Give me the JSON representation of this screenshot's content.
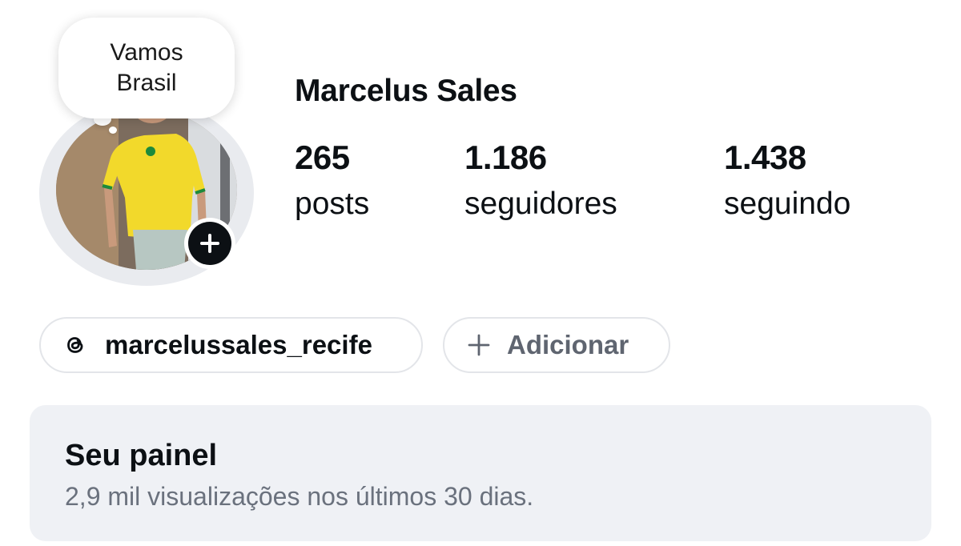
{
  "note": {
    "line1": "Vamos",
    "line2": "Brasil"
  },
  "profile": {
    "name": "Marcelus Sales",
    "stats": [
      {
        "value": "265",
        "label": "posts"
      },
      {
        "value": "1.186",
        "label": "seguidores"
      },
      {
        "value": "1.438",
        "label": "seguindo"
      }
    ]
  },
  "links": {
    "threads_handle": "marcelussales_recife",
    "add_label": "Adicionar"
  },
  "dashboard": {
    "title": "Seu painel",
    "subtitle": "2,9 mil visualizações nos últimos 30 dias."
  },
  "icons": {
    "threads": "threads-logo-icon",
    "add_story": "plus-icon",
    "add_link": "plus-icon"
  },
  "colors": {
    "text": "#0c1014",
    "muted": "#6a717d",
    "panel_bg": "#eff1f5",
    "border": "#e3e5e9"
  }
}
